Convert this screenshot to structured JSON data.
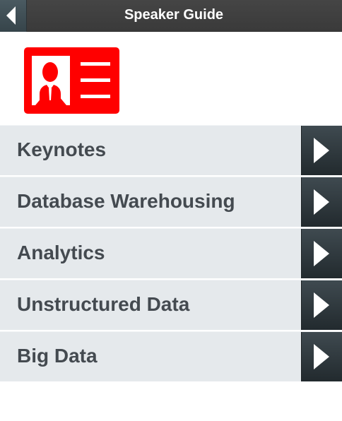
{
  "header": {
    "title": "Speaker Guide",
    "back_icon": "back-arrow-icon"
  },
  "logo": {
    "icon": "speaker-profile-card-icon",
    "color": "#ff0000"
  },
  "menu": {
    "items": [
      {
        "label": "Keynotes",
        "icon": "chevron-right-icon"
      },
      {
        "label": "Database Warehousing",
        "icon": "chevron-right-icon"
      },
      {
        "label": "Analytics",
        "icon": "chevron-right-icon"
      },
      {
        "label": "Unstructured Data",
        "icon": "chevron-right-icon"
      },
      {
        "label": "Big Data",
        "icon": "chevron-right-icon"
      }
    ]
  }
}
